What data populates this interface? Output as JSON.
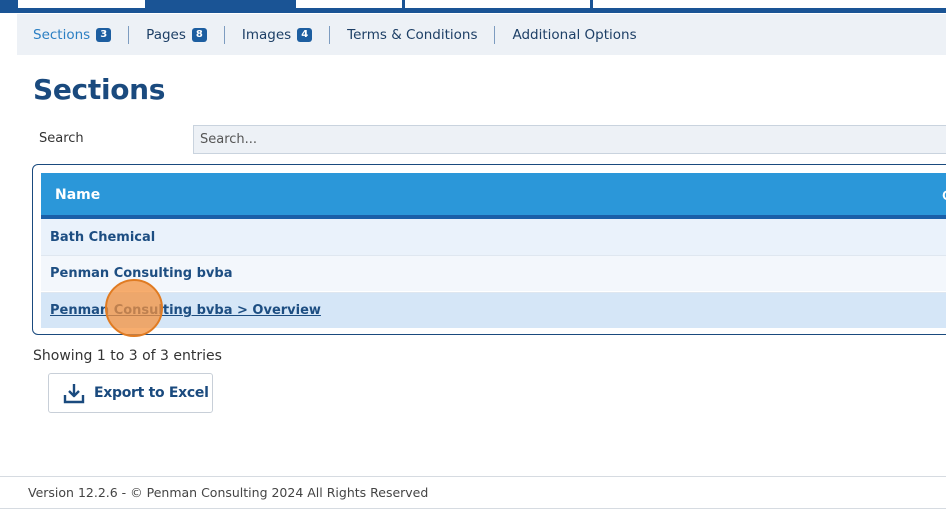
{
  "subnav": {
    "items": [
      {
        "label": "Sections",
        "badge": "3"
      },
      {
        "label": "Pages",
        "badge": "8"
      },
      {
        "label": "Images",
        "badge": "4"
      },
      {
        "label": "Terms & Conditions",
        "badge": null
      },
      {
        "label": "Additional Options",
        "badge": null
      }
    ]
  },
  "page": {
    "title": "Sections"
  },
  "search": {
    "label": "Search",
    "placeholder": "Search..."
  },
  "table": {
    "columns": [
      "Name"
    ],
    "rows": [
      "Bath Chemical",
      "Penman Consulting bvba",
      "Penman Consulting bvba > Overview"
    ]
  },
  "info": {
    "showing": "Showing 1 to 3 of 3 entries"
  },
  "export": {
    "label": "Export to Excel",
    "icon": "download-icon"
  },
  "footer": {
    "text": "Version 12.2.6 - © Penman Consulting 2024 All Rights Reserved"
  },
  "colors": {
    "brand": "#1a4a7e",
    "header": "#2b97d9",
    "accent": "#f4923e"
  }
}
